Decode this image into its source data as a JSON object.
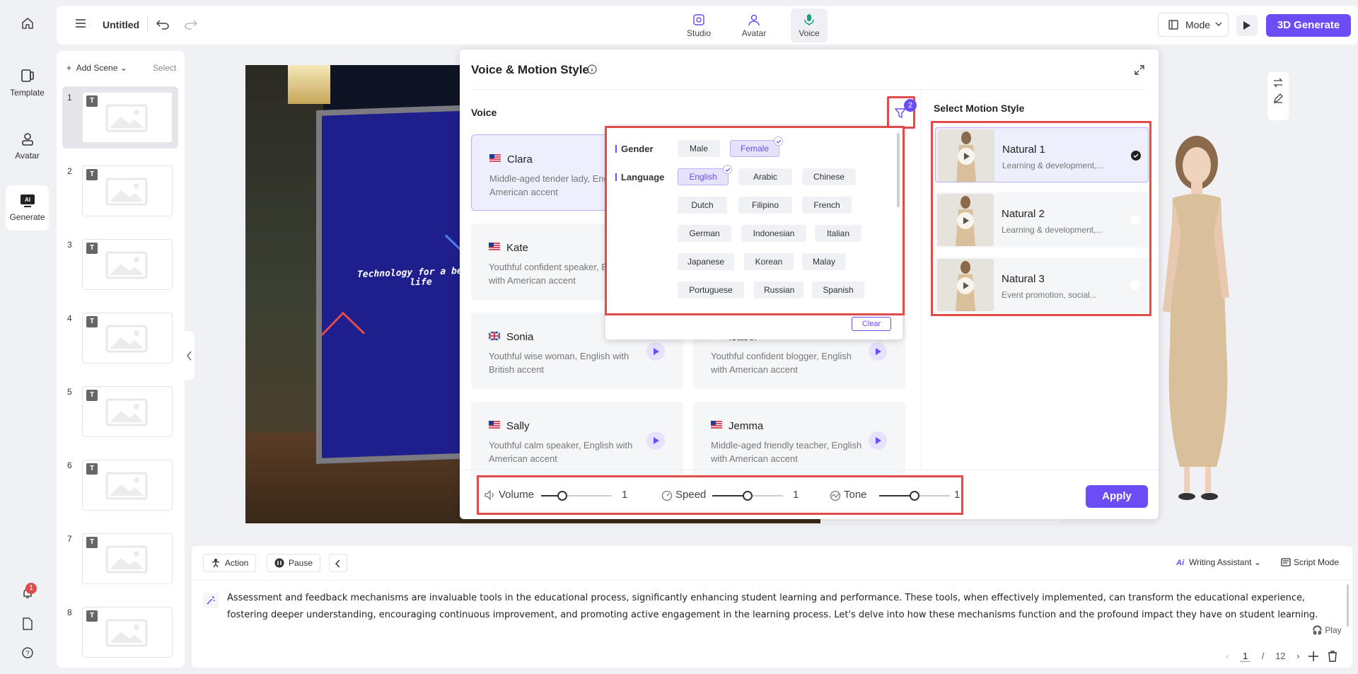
{
  "rail": {
    "items": [
      {
        "label": ""
      },
      {
        "label": "Template"
      },
      {
        "label": "Avatar"
      },
      {
        "label": "Generate"
      }
    ],
    "notification_count": "1"
  },
  "topbar": {
    "title": "Untitled",
    "tabs": [
      {
        "label": "Studio"
      },
      {
        "label": "Avatar"
      },
      {
        "label": "Voice"
      }
    ],
    "mode_label": "Mode",
    "generate_label": "3D Generate"
  },
  "scenes": {
    "add_label": "Add Scene",
    "select_label": "Select",
    "tag": "T",
    "items": [
      "1",
      "2",
      "3",
      "4",
      "5",
      "6",
      "7",
      "8"
    ]
  },
  "stage": {
    "board_text": "Technology for a better life"
  },
  "modal": {
    "title": "Voice & Motion Style",
    "voice_label": "Voice",
    "filter_count": "2",
    "voices": [
      {
        "name": "Clara",
        "desc": "Middle-aged tender lady, English with American accent",
        "flag": "us"
      },
      {
        "name": "Kate",
        "desc": "Youthful confident speaker, English with American accent",
        "flag": "us"
      },
      {
        "name": "Sonia",
        "desc": "Youthful wise woman, English with British accent",
        "flag": "uk"
      },
      {
        "name": "Isabel",
        "desc": "Youthful confident blogger, English with American accent",
        "flag": "us"
      },
      {
        "name": "Sally",
        "desc": "Youthful calm speaker, English with American accent",
        "flag": "us"
      },
      {
        "name": "Jemma",
        "desc": "Middle-aged friendly teacher, English with American accent",
        "flag": "us"
      }
    ],
    "filter": {
      "gender_label": "Gender",
      "language_label": "Language",
      "genders": [
        "Male",
        "Female"
      ],
      "selected_gender": "Female",
      "languages": [
        "English",
        "Arabic",
        "Chinese",
        "Dutch",
        "Filipino",
        "French",
        "German",
        "Indonesian",
        "Italian",
        "Japanese",
        "Korean",
        "Malay",
        "Portuguese",
        "Russian",
        "Spanish"
      ],
      "selected_language": "English",
      "clear_label": "Clear"
    },
    "motion_label": "Select Motion Style",
    "motions": [
      {
        "name": "Natural 1",
        "desc": "Learning & development,..."
      },
      {
        "name": "Natural 2",
        "desc": "Learning & development,..."
      },
      {
        "name": "Natural 3",
        "desc": "Event promotion, social..."
      }
    ],
    "selected_motion": "Natural 1",
    "sliders": [
      {
        "label": "Volume",
        "value": "1",
        "fraction": 0.3
      },
      {
        "label": "Speed",
        "value": "1",
        "fraction": 0.5
      },
      {
        "label": "Tone",
        "value": "1",
        "fraction": 0.5
      }
    ],
    "apply_label": "Apply"
  },
  "script": {
    "action_label": "Action",
    "pause_label": "Pause",
    "writing_assistant_label": "Writing Assistant",
    "script_mode_label": "Script Mode",
    "text": "Assessment and feedback mechanisms are invaluable tools in the educational process, significantly enhancing student learning and performance. These tools, when effectively implemented, can transform the educational experience, fostering deeper understanding, encouraging continuous improvement, and promoting active engagement in the learning process. Let's delve into how these mechanisms function and the profound impact they have on student learning.",
    "play_label": "Play",
    "page_current": "1",
    "page_sep": "/",
    "page_total": "12"
  },
  "colors": {
    "accent": "#6c4cf5",
    "highlight": "#e04b4b"
  }
}
